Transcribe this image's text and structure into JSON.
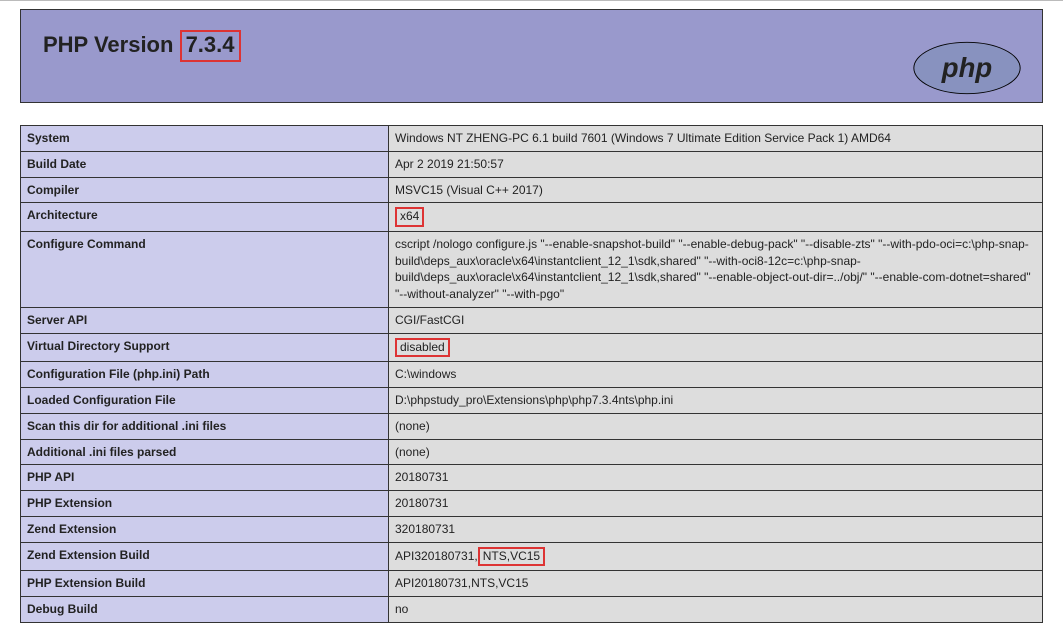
{
  "header": {
    "title_prefix": "PHP Version",
    "title_version": "7.3.4",
    "logo_text": "php"
  },
  "rows": [
    {
      "key": "System",
      "value": "Windows NT ZHENG-PC 6.1 build 7601 (Windows 7 Ultimate Edition Service Pack 1) AMD64",
      "highlight": false
    },
    {
      "key": "Build Date",
      "value": "Apr 2 2019 21:50:57",
      "highlight": false
    },
    {
      "key": "Compiler",
      "value": "MSVC15 (Visual C++ 2017)",
      "highlight": false
    },
    {
      "key": "Architecture",
      "value": "x64",
      "highlight": true
    },
    {
      "key": "Configure Command",
      "value": "cscript /nologo configure.js \"--enable-snapshot-build\" \"--enable-debug-pack\" \"--disable-zts\" \"--with-pdo-oci=c:\\php-snap-build\\deps_aux\\oracle\\x64\\instantclient_12_1\\sdk,shared\" \"--with-oci8-12c=c:\\php-snap-build\\deps_aux\\oracle\\x64\\instantclient_12_1\\sdk,shared\" \"--enable-object-out-dir=../obj/\" \"--enable-com-dotnet=shared\" \"--without-analyzer\" \"--with-pgo\"",
      "highlight": false
    },
    {
      "key": "Server API",
      "value": "CGI/FastCGI",
      "highlight": false
    },
    {
      "key": "Virtual Directory Support",
      "value": "disabled",
      "highlight": true
    },
    {
      "key": "Configuration File (php.ini) Path",
      "value": "C:\\windows",
      "highlight": false
    },
    {
      "key": "Loaded Configuration File",
      "value": "D:\\phpstudy_pro\\Extensions\\php\\php7.3.4nts\\php.ini",
      "highlight": false
    },
    {
      "key": "Scan this dir for additional .ini files",
      "value": "(none)",
      "highlight": false
    },
    {
      "key": "Additional .ini files parsed",
      "value": "(none)",
      "highlight": false
    },
    {
      "key": "PHP API",
      "value": "20180731",
      "highlight": false
    },
    {
      "key": "PHP Extension",
      "value": "20180731",
      "highlight": false
    },
    {
      "key": "Zend Extension",
      "value": "320180731",
      "highlight": false
    },
    {
      "key": "Zend Extension Build",
      "value_pre": "API320180731,",
      "value_hi": "NTS,VC15",
      "highlight": "split"
    },
    {
      "key": "PHP Extension Build",
      "value": "API20180731,NTS,VC15",
      "highlight": false
    },
    {
      "key": "Debug Build",
      "value": "no",
      "highlight": false
    }
  ]
}
